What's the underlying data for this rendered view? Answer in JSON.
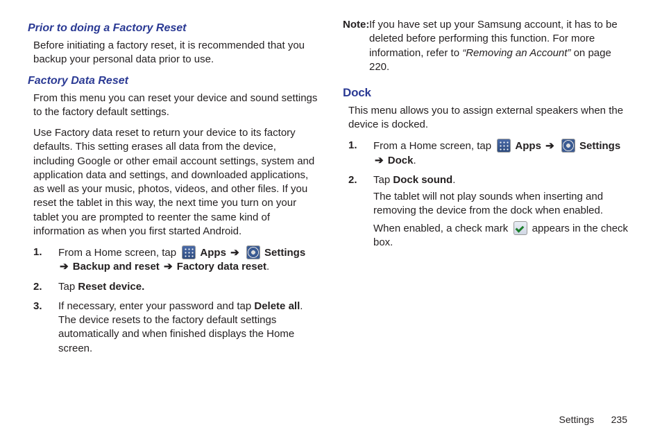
{
  "left": {
    "sub1_title": "Prior to doing a Factory Reset",
    "sub1_body": "Before initiating a factory reset, it is recommended that you backup your personal data prior to use.",
    "sub2_title": "Factory Data Reset",
    "sub2_body1": "From this menu you can reset your device and sound settings to the factory default settings.",
    "sub2_body2": "Use Factory data reset to return your device to its factory defaults. This setting erases all data from the device, including Google or other email account settings, system and application data and settings, and downloaded applications, as well as your music, photos, videos, and other files. If you reset the tablet in this way, the next time you turn on your tablet you are prompted to reenter the same kind of information as when you first started Android.",
    "step1_pre": "From a Home screen, tap ",
    "apps_label": "Apps",
    "arrow": "➔",
    "settings_label": "Settings",
    "step1_line2_a": "Backup and reset",
    "step1_line2_b": "Factory data reset",
    "step2_pre": "Tap ",
    "step2_bold": "Reset device.",
    "step3_a": "If necessary, enter your password and tap ",
    "step3_bold": "Delete all",
    "step3_b": ". The device resets to the factory default settings automatically and when finished displays the Home screen.",
    "num1": "1.",
    "num2": "2.",
    "num3": "3."
  },
  "right": {
    "note_label": "Note:",
    "note_body_a": "If you have set up your Samsung account, it has to be deleted before performing this function. For more information, refer to ",
    "note_body_italic": "“Removing an Account”",
    "note_body_b": "  on page 220.",
    "dock_title": "Dock",
    "dock_body": "This menu allows you to assign external speakers when the device is docked.",
    "step1_pre": "From a Home screen, tap ",
    "apps_label": "Apps",
    "arrow": "➔",
    "settings_label": "Settings",
    "step1_line2": "Dock",
    "step2_pre": "Tap ",
    "step2_bold": "Dock sound",
    "step2_body": "The tablet will not play sounds when inserting and removing the device from the dock when enabled.",
    "step2_body2_a": "When enabled, a check mark ",
    "step2_body2_b": " appears in the check box.",
    "num1": "1.",
    "num2": "2."
  },
  "footer": {
    "section": "Settings",
    "page": "235"
  }
}
